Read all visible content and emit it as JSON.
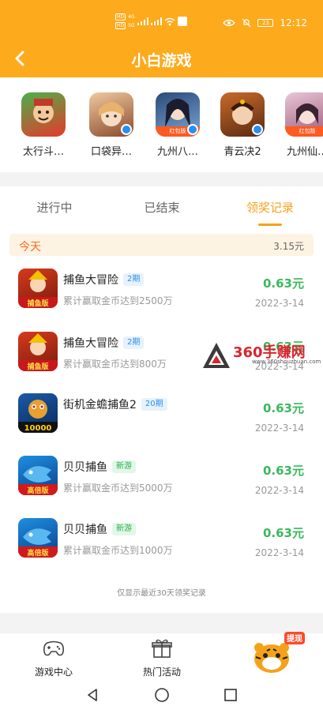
{
  "status_bar": {
    "sim1": "HD",
    "sim2": "HD",
    "net1": "4G",
    "net2": "5G",
    "battery": "23",
    "time": "12:12"
  },
  "header": {
    "title": "小白游戏",
    "back_icon": "chevron-left-icon"
  },
  "games": [
    {
      "name": "太行斗…",
      "tag": ""
    },
    {
      "name": "口袋异…",
      "tag": ""
    },
    {
      "name": "九州八…",
      "tag": "红包版"
    },
    {
      "name": "青云决2",
      "tag": ""
    },
    {
      "name": "九州仙…",
      "tag": "红包版"
    }
  ],
  "tabs": [
    {
      "label": "进行中"
    },
    {
      "label": "已结束"
    },
    {
      "label": "领奖记录"
    }
  ],
  "day": {
    "label": "今天",
    "total": "3.15元"
  },
  "records": [
    {
      "name": "捕鱼大冒险",
      "chip": "2期",
      "desc": "累计赢取金币达到2500万",
      "amount": "0.63元",
      "date": "2022-3-14",
      "icon_text": "捕鱼版"
    },
    {
      "name": "捕鱼大冒险",
      "chip": "2期",
      "desc": "累计赢取金币达到800万",
      "amount": "0.63元",
      "date": "2022-3-14",
      "icon_text": "捕鱼版"
    },
    {
      "name": "街机金蟾捕鱼2",
      "chip": "20期",
      "desc": "",
      "amount": "0.63元",
      "date": "2022-3-14",
      "icon_text": "10000"
    },
    {
      "name": "贝贝捕鱼",
      "chip": "新游",
      "desc": "累计赢取金币达到5000万",
      "amount": "0.63元",
      "date": "2022-3-14",
      "icon_text": "高倍版"
    },
    {
      "name": "贝贝捕鱼",
      "chip": "新游",
      "desc": "累计赢取金币达到1000万",
      "amount": "0.63元",
      "date": "2022-3-14",
      "icon_text": "高倍版"
    }
  ],
  "footnote": "仅显示最近30天领奖记录",
  "watermark": {
    "text": "360手赚网",
    "url": "www.360shouzhuan.com"
  },
  "bottom_nav": {
    "items": [
      {
        "label": "游戏中心",
        "icon": "gamepad-icon"
      },
      {
        "label": "热门活动",
        "icon": "gift-icon"
      }
    ],
    "mascot_badge": "提现"
  },
  "colors": {
    "brand": "#fdaa1c",
    "accent": "#f5a21b",
    "amount": "#3bb85c",
    "day_label": "#ff6a1a"
  }
}
